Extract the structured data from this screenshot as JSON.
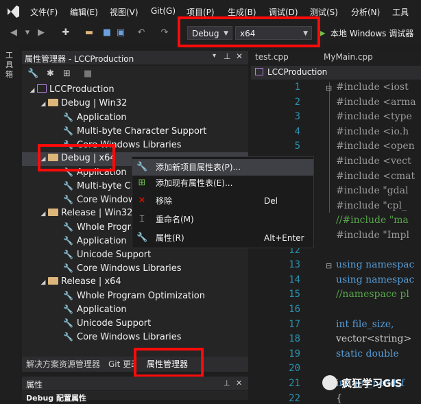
{
  "menu": [
    "文件(F)",
    "编辑(E)",
    "视图(V)",
    "Git(G)",
    "项目(P)",
    "生成(B)",
    "调试(D)",
    "测试(S)",
    "分析(N)",
    "工具"
  ],
  "toolbar": {
    "config_value": "Debug",
    "platform_value": "x64",
    "debugger_label": "本地 Windows 调试器"
  },
  "property_manager": {
    "title": "属性管理器 - LCCProduction",
    "project": "LCCProduction",
    "configs": [
      {
        "label": "Debug | Win32",
        "sheets": [
          "Application",
          "Multi-byte Character Support",
          "Core Windows Libraries"
        ]
      },
      {
        "label": "Debug | x64",
        "sheets": [
          "Application",
          "Multi-byte Ch",
          "Core Window"
        ]
      },
      {
        "label": "Release | Win32",
        "sheets": [
          "Whole Progra",
          "Application",
          "Unicode Support",
          "Core Windows Libraries"
        ]
      },
      {
        "label": "Release | x64",
        "sheets": [
          "Whole Program Optimization",
          "Application",
          "Unicode Support",
          "Core Windows Libraries"
        ]
      }
    ]
  },
  "side_strip_label": "工具箱",
  "bottom_tabs": [
    "解决方案资源管理器",
    "Git 更改",
    "属性管理器"
  ],
  "properties_panel": {
    "title": "属性",
    "subtitle": "Debug 配置属性"
  },
  "editor": {
    "tabs": [
      "test.cpp",
      "MyMain.cpp"
    ],
    "nav": "LCCProduction",
    "lines": [
      {
        "n": "1",
        "code": "#include <iost"
      },
      {
        "n": "2",
        "code": "#include <arma"
      },
      {
        "n": "3",
        "code": "#include <type"
      },
      {
        "n": "4",
        "code": "#include <io.h"
      },
      {
        "n": "5",
        "code": "#include <open"
      },
      {
        "n": "6",
        "code": "#include <vect"
      },
      {
        "n": "7",
        "code": "#include <cmat"
      },
      {
        "n": "8",
        "code": "#include \"gdal"
      },
      {
        "n": "9",
        "code": "#include \"cpl_"
      },
      {
        "n": "10",
        "code": "//#include \"ma"
      },
      {
        "n": "11",
        "code": "#include \"Impl"
      },
      {
        "n": "12",
        "code": ""
      },
      {
        "n": "13",
        "code": "using namespac"
      },
      {
        "n": "14",
        "code": "using namespac"
      },
      {
        "n": "15",
        "code": "//namespace pl"
      },
      {
        "n": "16",
        "code": ""
      },
      {
        "n": "17",
        "code": "int file_size,"
      },
      {
        "n": "18",
        "code": "vector<string>"
      },
      {
        "n": "19",
        "code": "static double"
      },
      {
        "n": "20",
        "code": ""
      },
      {
        "n": "21",
        "code": "int get_need_f"
      },
      {
        "n": "22",
        "code": "{"
      }
    ]
  },
  "context_menu": [
    {
      "icon": "add-sheet-icon",
      "label": "添加新项目属性表(P)...",
      "shortcut": ""
    },
    {
      "icon": "add-existing-sheet-icon",
      "label": "添加现有属性表(E)...",
      "shortcut": ""
    },
    {
      "icon": "delete-icon",
      "label": "移除",
      "shortcut": "Del"
    },
    {
      "icon": "rename-icon",
      "label": "重命名(M)",
      "shortcut": ""
    },
    {
      "icon": "wrench-icon",
      "label": "属性(R)",
      "shortcut": "Alt+Enter"
    }
  ],
  "watermark": "疯狂学习GIS",
  "colors": {
    "highlight": "#ff0a0a",
    "accent": "#007acc",
    "folder": "#dcb67a"
  }
}
